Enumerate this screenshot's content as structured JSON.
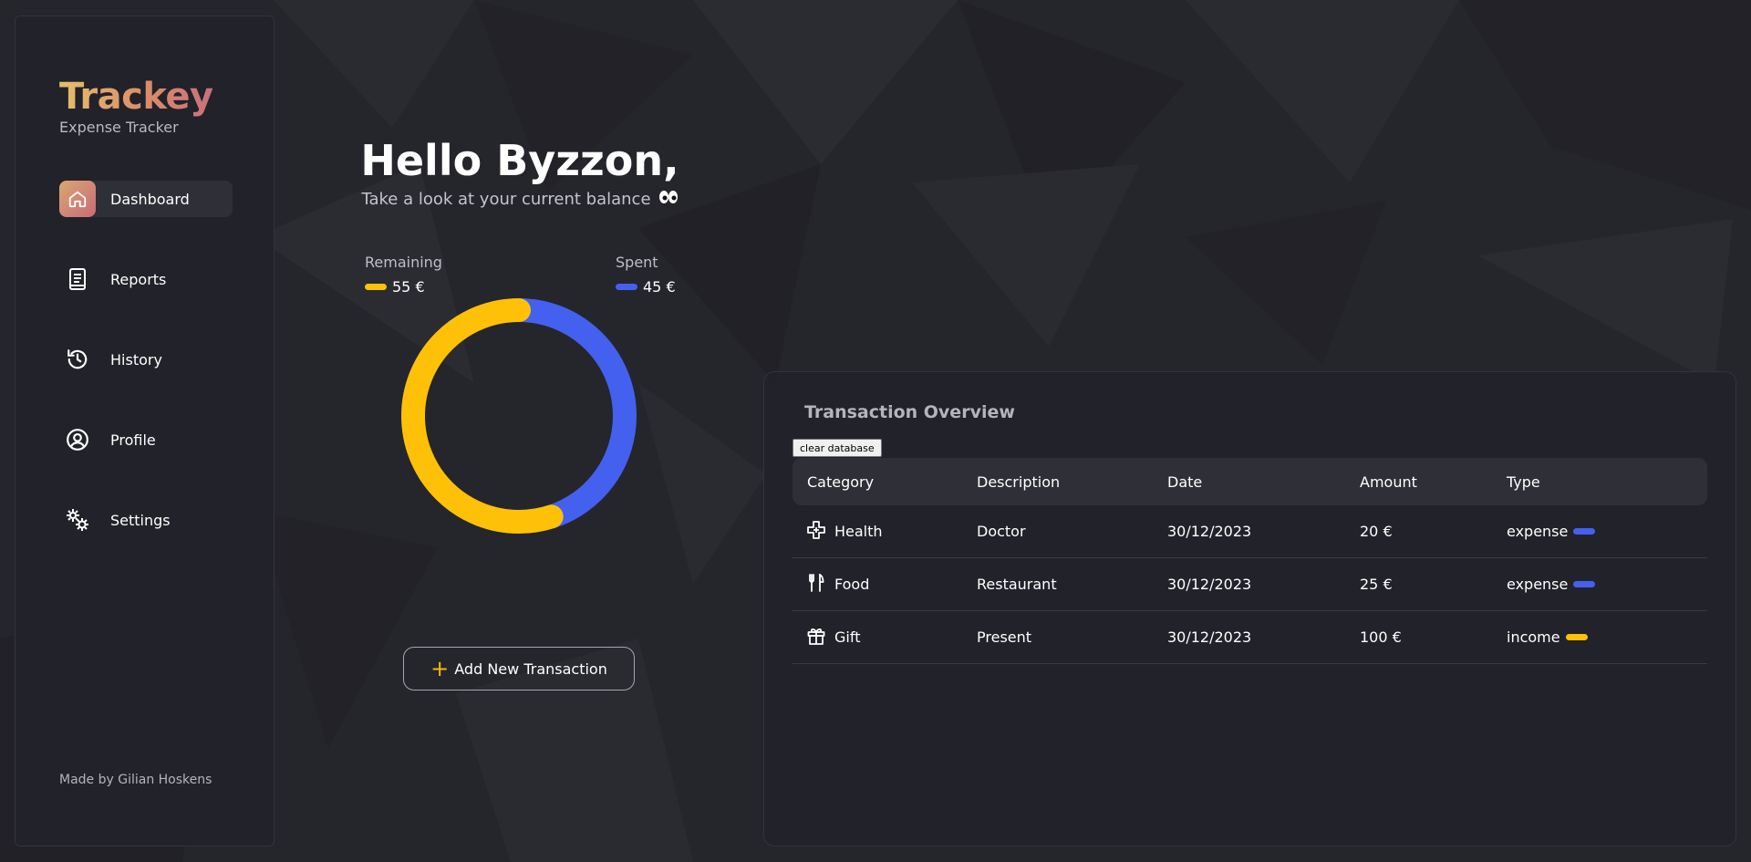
{
  "app": {
    "brand": "Trackey",
    "tagline": "Expense Tracker",
    "credits": "Made by Gilian Hoskens"
  },
  "sidebar": {
    "items": [
      {
        "label": "Dashboard",
        "icon": "home-icon",
        "active": true
      },
      {
        "label": "Reports",
        "icon": "report-icon",
        "active": false
      },
      {
        "label": "History",
        "icon": "history-icon",
        "active": false
      },
      {
        "label": "Profile",
        "icon": "profile-icon",
        "active": false
      },
      {
        "label": "Settings",
        "icon": "settings-icon",
        "active": false
      }
    ]
  },
  "greeting": {
    "title": "Hello Byzzon,",
    "subtitle": "Take a look at your current balance",
    "emoji_icon": "eyes-icon"
  },
  "balance": {
    "remaining_label": "Remaining",
    "remaining_value": "55 €",
    "spent_label": "Spent",
    "spent_value": "45 €"
  },
  "chart_data": {
    "type": "pie",
    "categories": [
      "Remaining",
      "Spent"
    ],
    "values": [
      55,
      45
    ],
    "colors": [
      "#ffc107",
      "#4361ee"
    ],
    "title": "",
    "legend_position": "top"
  },
  "actions": {
    "add_transaction": "Add New Transaction"
  },
  "transactions": {
    "title": "Transaction Overview",
    "clear_label": "clear database",
    "columns": [
      "Category",
      "Description",
      "Date",
      "Amount",
      "Type"
    ],
    "rows": [
      {
        "category": "Health",
        "icon": "health-cross-icon",
        "description": "Doctor",
        "date": "30/12/2023",
        "amount": "20 €",
        "type": "expense",
        "type_color": "#4361ee"
      },
      {
        "category": "Food",
        "icon": "fork-knife-icon",
        "description": "Restaurant",
        "date": "30/12/2023",
        "amount": "25 €",
        "type": "expense",
        "type_color": "#4361ee"
      },
      {
        "category": "Gift",
        "icon": "gift-icon",
        "description": "Present",
        "date": "30/12/2023",
        "amount": "100 €",
        "type": "income",
        "type_color": "#ffc107"
      }
    ]
  },
  "colors": {
    "accent_yellow": "#ffc107",
    "accent_blue": "#4361ee",
    "background": "#25252c",
    "panel": "#22222a"
  }
}
